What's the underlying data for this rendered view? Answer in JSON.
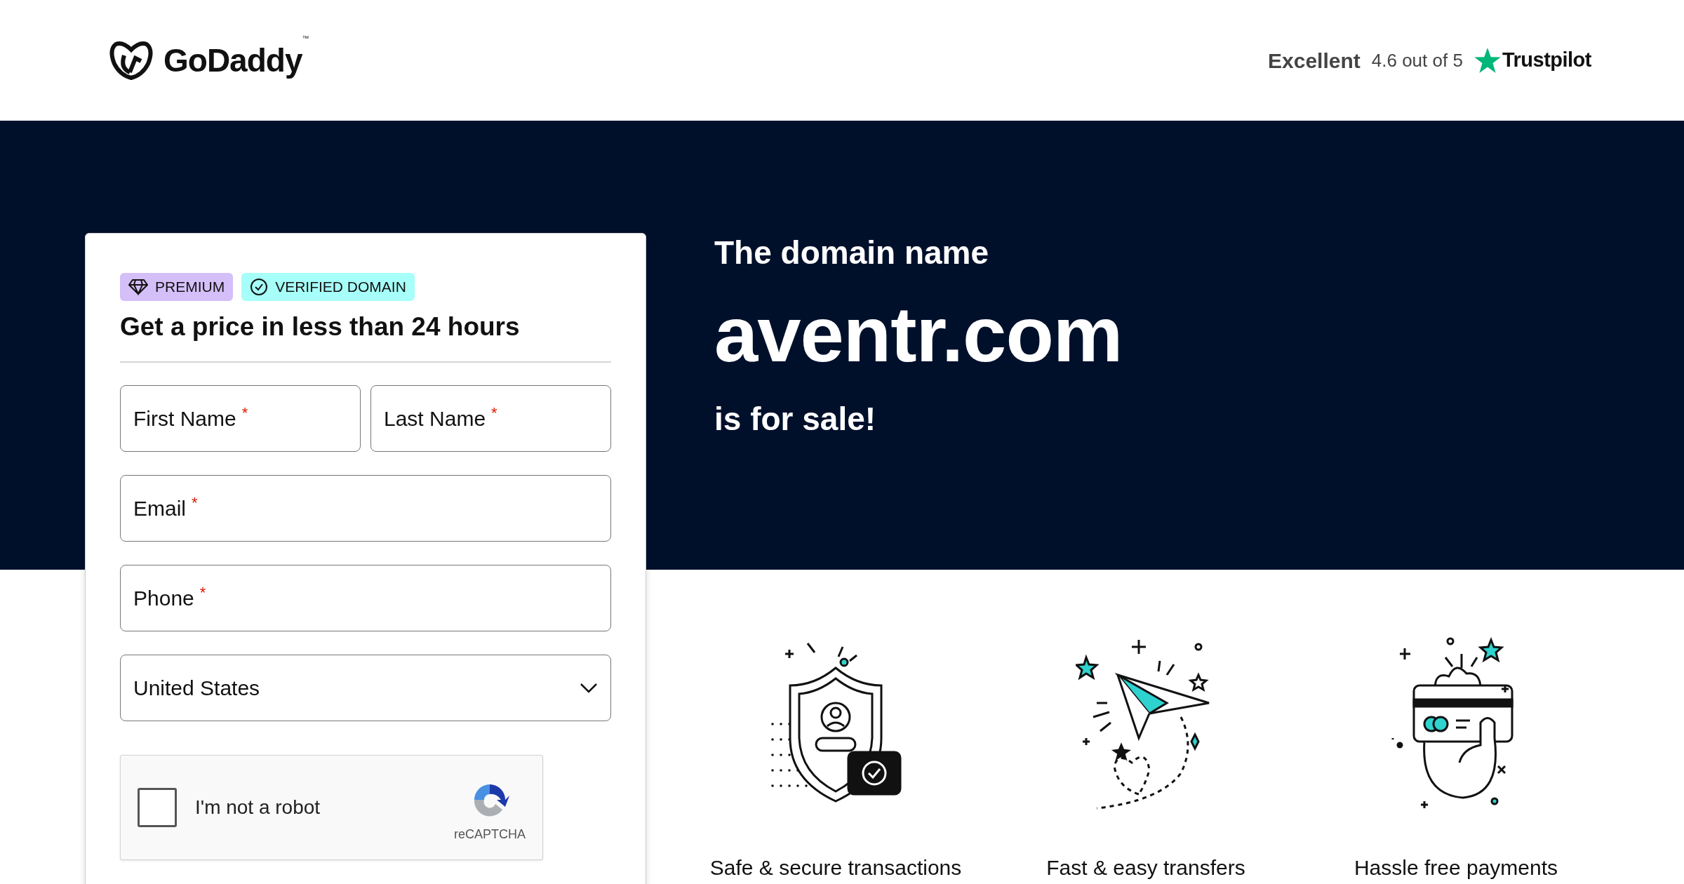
{
  "header": {
    "brand": "GoDaddy",
    "trademark": "™",
    "rating": {
      "label": "Excellent",
      "score": "4.6 out of 5",
      "provider": "Trustpilot"
    }
  },
  "form": {
    "badges": [
      {
        "label": "PREMIUM",
        "kind": "premium"
      },
      {
        "label": "VERIFIED DOMAIN",
        "kind": "verified"
      }
    ],
    "title": "Get a price in less than 24 hours",
    "fields": [
      {
        "placeholder": "First Name",
        "required_mark": "*",
        "kind": "half"
      },
      {
        "placeholder": "Last Name",
        "required_mark": "*",
        "kind": "half"
      },
      {
        "placeholder": "Email",
        "required_mark": "*",
        "kind": "full"
      },
      {
        "placeholder": "Phone",
        "required_mark": "*",
        "kind": "full"
      }
    ],
    "country": {
      "value": "United States"
    },
    "captcha": {
      "label": "I'm not a robot",
      "checked": false,
      "brand": "reCAPTCHA"
    }
  },
  "hero": {
    "intro": "The domain name",
    "domain": "aventr.com",
    "outro": "is for sale!"
  },
  "features": [
    {
      "label": "Safe & secure transactions",
      "kind": "shield"
    },
    {
      "label": "Fast & easy transfers",
      "kind": "plane"
    },
    {
      "label": "Hassle free payments",
      "kind": "card"
    }
  ]
}
